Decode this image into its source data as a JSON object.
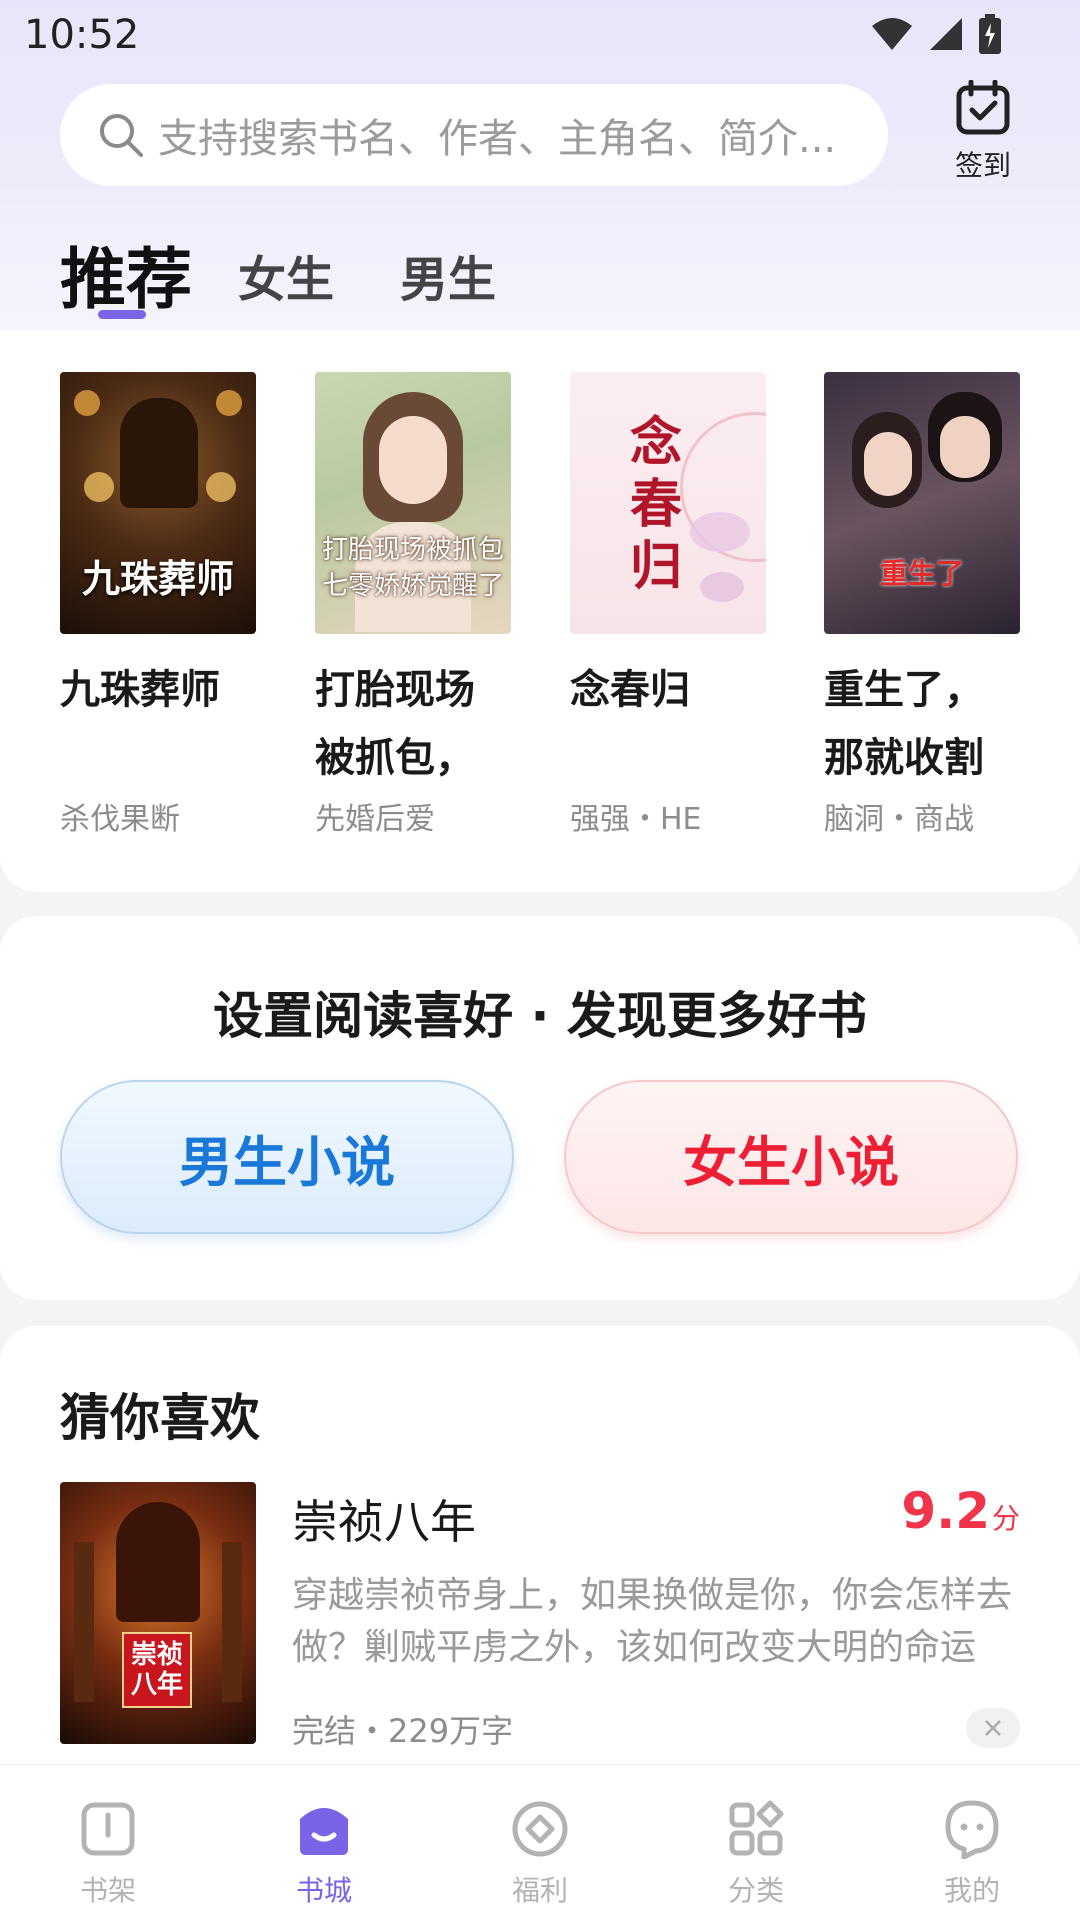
{
  "status_bar": {
    "time": "10:52"
  },
  "search": {
    "placeholder": "支持搜索书名、作者、主角名、简介..."
  },
  "checkin": {
    "label": "签到"
  },
  "tabs": [
    {
      "label": "推荐",
      "active": true
    },
    {
      "label": "女生",
      "active": false
    },
    {
      "label": "男生",
      "active": false
    }
  ],
  "featured_books": [
    {
      "title": "九珠葬师",
      "tags": "杀伐果断",
      "cover_title": "九珠葬师"
    },
    {
      "title": "打胎现场被抓包，",
      "tags": "先婚后爱",
      "cover_title": "打胎现场被抓包 七零娇娇觉醒了"
    },
    {
      "title": "念春归",
      "tags": "强强・HE",
      "cover_title": "念春归"
    },
    {
      "title": "重生了，那就收割",
      "tags": "脑洞・商战",
      "cover_title": "重生了"
    }
  ],
  "preference": {
    "title": "设置阅读喜好 · 发现更多好书",
    "male_label": "男生小说",
    "female_label": "女生小说"
  },
  "guess": {
    "title": "猜你喜欢",
    "book": {
      "name": "崇祯八年",
      "score": "9.2",
      "score_unit": "分",
      "description": "穿越崇祯帝身上，如果换做是你，你会怎样去做？剿贼平虏之外，该如何改变大明的命运",
      "meta": "完结・229万字",
      "cover_title": "崇祯八年"
    }
  },
  "bottom_nav": [
    {
      "label": "书架",
      "icon": "bookshelf-icon",
      "active": false
    },
    {
      "label": "书城",
      "icon": "bookstore-icon",
      "active": true
    },
    {
      "label": "福利",
      "icon": "welfare-icon",
      "active": false
    },
    {
      "label": "分类",
      "icon": "category-icon",
      "active": false
    },
    {
      "label": "我的",
      "icon": "profile-icon",
      "active": false
    }
  ],
  "colors": {
    "accent": "#7b63e8",
    "score": "#f0354a",
    "male": "#1a79d8",
    "female": "#ee1f35"
  }
}
